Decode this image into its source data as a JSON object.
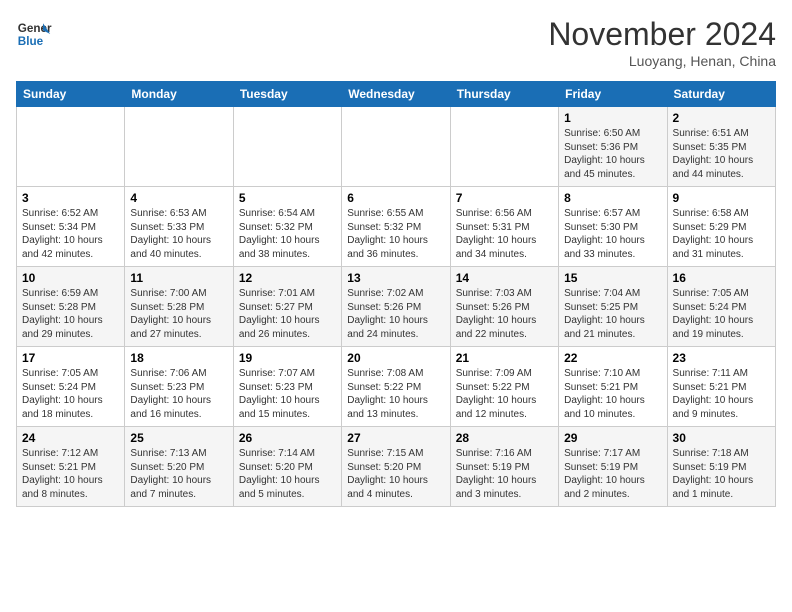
{
  "header": {
    "logo_line1": "General",
    "logo_line2": "Blue",
    "month": "November 2024",
    "location": "Luoyang, Henan, China"
  },
  "days_of_week": [
    "Sunday",
    "Monday",
    "Tuesday",
    "Wednesday",
    "Thursday",
    "Friday",
    "Saturday"
  ],
  "weeks": [
    [
      {
        "day": "",
        "info": ""
      },
      {
        "day": "",
        "info": ""
      },
      {
        "day": "",
        "info": ""
      },
      {
        "day": "",
        "info": ""
      },
      {
        "day": "",
        "info": ""
      },
      {
        "day": "1",
        "info": "Sunrise: 6:50 AM\nSunset: 5:36 PM\nDaylight: 10 hours\nand 45 minutes."
      },
      {
        "day": "2",
        "info": "Sunrise: 6:51 AM\nSunset: 5:35 PM\nDaylight: 10 hours\nand 44 minutes."
      }
    ],
    [
      {
        "day": "3",
        "info": "Sunrise: 6:52 AM\nSunset: 5:34 PM\nDaylight: 10 hours\nand 42 minutes."
      },
      {
        "day": "4",
        "info": "Sunrise: 6:53 AM\nSunset: 5:33 PM\nDaylight: 10 hours\nand 40 minutes."
      },
      {
        "day": "5",
        "info": "Sunrise: 6:54 AM\nSunset: 5:32 PM\nDaylight: 10 hours\nand 38 minutes."
      },
      {
        "day": "6",
        "info": "Sunrise: 6:55 AM\nSunset: 5:32 PM\nDaylight: 10 hours\nand 36 minutes."
      },
      {
        "day": "7",
        "info": "Sunrise: 6:56 AM\nSunset: 5:31 PM\nDaylight: 10 hours\nand 34 minutes."
      },
      {
        "day": "8",
        "info": "Sunrise: 6:57 AM\nSunset: 5:30 PM\nDaylight: 10 hours\nand 33 minutes."
      },
      {
        "day": "9",
        "info": "Sunrise: 6:58 AM\nSunset: 5:29 PM\nDaylight: 10 hours\nand 31 minutes."
      }
    ],
    [
      {
        "day": "10",
        "info": "Sunrise: 6:59 AM\nSunset: 5:28 PM\nDaylight: 10 hours\nand 29 minutes."
      },
      {
        "day": "11",
        "info": "Sunrise: 7:00 AM\nSunset: 5:28 PM\nDaylight: 10 hours\nand 27 minutes."
      },
      {
        "day": "12",
        "info": "Sunrise: 7:01 AM\nSunset: 5:27 PM\nDaylight: 10 hours\nand 26 minutes."
      },
      {
        "day": "13",
        "info": "Sunrise: 7:02 AM\nSunset: 5:26 PM\nDaylight: 10 hours\nand 24 minutes."
      },
      {
        "day": "14",
        "info": "Sunrise: 7:03 AM\nSunset: 5:26 PM\nDaylight: 10 hours\nand 22 minutes."
      },
      {
        "day": "15",
        "info": "Sunrise: 7:04 AM\nSunset: 5:25 PM\nDaylight: 10 hours\nand 21 minutes."
      },
      {
        "day": "16",
        "info": "Sunrise: 7:05 AM\nSunset: 5:24 PM\nDaylight: 10 hours\nand 19 minutes."
      }
    ],
    [
      {
        "day": "17",
        "info": "Sunrise: 7:05 AM\nSunset: 5:24 PM\nDaylight: 10 hours\nand 18 minutes."
      },
      {
        "day": "18",
        "info": "Sunrise: 7:06 AM\nSunset: 5:23 PM\nDaylight: 10 hours\nand 16 minutes."
      },
      {
        "day": "19",
        "info": "Sunrise: 7:07 AM\nSunset: 5:23 PM\nDaylight: 10 hours\nand 15 minutes."
      },
      {
        "day": "20",
        "info": "Sunrise: 7:08 AM\nSunset: 5:22 PM\nDaylight: 10 hours\nand 13 minutes."
      },
      {
        "day": "21",
        "info": "Sunrise: 7:09 AM\nSunset: 5:22 PM\nDaylight: 10 hours\nand 12 minutes."
      },
      {
        "day": "22",
        "info": "Sunrise: 7:10 AM\nSunset: 5:21 PM\nDaylight: 10 hours\nand 10 minutes."
      },
      {
        "day": "23",
        "info": "Sunrise: 7:11 AM\nSunset: 5:21 PM\nDaylight: 10 hours\nand 9 minutes."
      }
    ],
    [
      {
        "day": "24",
        "info": "Sunrise: 7:12 AM\nSunset: 5:21 PM\nDaylight: 10 hours\nand 8 minutes."
      },
      {
        "day": "25",
        "info": "Sunrise: 7:13 AM\nSunset: 5:20 PM\nDaylight: 10 hours\nand 7 minutes."
      },
      {
        "day": "26",
        "info": "Sunrise: 7:14 AM\nSunset: 5:20 PM\nDaylight: 10 hours\nand 5 minutes."
      },
      {
        "day": "27",
        "info": "Sunrise: 7:15 AM\nSunset: 5:20 PM\nDaylight: 10 hours\nand 4 minutes."
      },
      {
        "day": "28",
        "info": "Sunrise: 7:16 AM\nSunset: 5:19 PM\nDaylight: 10 hours\nand 3 minutes."
      },
      {
        "day": "29",
        "info": "Sunrise: 7:17 AM\nSunset: 5:19 PM\nDaylight: 10 hours\nand 2 minutes."
      },
      {
        "day": "30",
        "info": "Sunrise: 7:18 AM\nSunset: 5:19 PM\nDaylight: 10 hours\nand 1 minute."
      }
    ]
  ]
}
